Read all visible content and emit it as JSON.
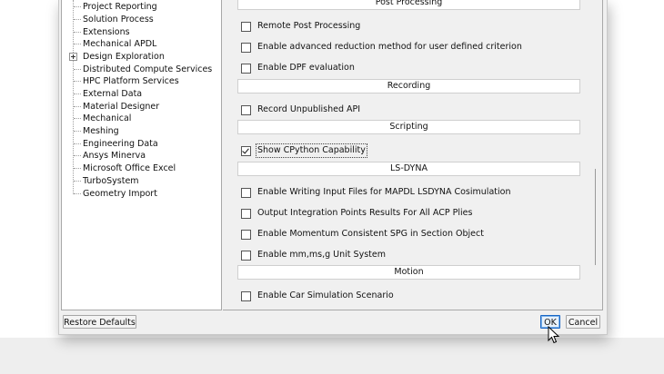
{
  "tree": {
    "items": [
      {
        "label": "Project Reporting",
        "expandable": false
      },
      {
        "label": "Solution Process",
        "expandable": false
      },
      {
        "label": "Extensions",
        "expandable": false
      },
      {
        "label": "Mechanical APDL",
        "expandable": false
      },
      {
        "label": "Design Exploration",
        "expandable": true
      },
      {
        "label": "Distributed Compute Services",
        "expandable": false
      },
      {
        "label": "HPC Platform Services",
        "expandable": false
      },
      {
        "label": "External Data",
        "expandable": false
      },
      {
        "label": "Material Designer",
        "expandable": false
      },
      {
        "label": "Mechanical",
        "expandable": false
      },
      {
        "label": "Meshing",
        "expandable": false
      },
      {
        "label": "Engineering Data",
        "expandable": false
      },
      {
        "label": "Ansys Minerva",
        "expandable": false
      },
      {
        "label": "Microsoft Office Excel",
        "expandable": false
      },
      {
        "label": "TurboSystem",
        "expandable": false
      },
      {
        "label": "Geometry Import",
        "expandable": false
      }
    ]
  },
  "settings": {
    "sections": {
      "post_processing": "Post Processing",
      "recording": "Recording",
      "scripting": "Scripting",
      "lsdyna": "LS-DYNA",
      "motion": "Motion"
    },
    "options": {
      "remote_post": {
        "label": "Remote Post Processing",
        "checked": false
      },
      "adv_reduction": {
        "label": "Enable advanced reduction method for user defined criterion",
        "checked": false
      },
      "dpf_eval": {
        "label": "Enable DPF evaluation",
        "checked": false
      },
      "record_unpublished": {
        "label": "Record Unpublished API",
        "checked": false
      },
      "cpython": {
        "label": "Show CPython Capability",
        "checked": true
      },
      "writing_input": {
        "label": "Enable Writing Input Files for MAPDL LSDYNA Cosimulation",
        "checked": false
      },
      "integration_points": {
        "label": "Output Integration Points Results For All ACP Plies",
        "checked": false
      },
      "momentum_spg": {
        "label": "Enable Momentum Consistent SPG in Section Object",
        "checked": false
      },
      "unit_system": {
        "label": "Enable mm,ms,g Unit System",
        "checked": false
      },
      "car_sim": {
        "label": "Enable Car Simulation Scenario",
        "checked": false
      }
    }
  },
  "footer": {
    "restore_defaults": "Restore Defaults",
    "ok": "OK",
    "cancel": "Cancel"
  }
}
